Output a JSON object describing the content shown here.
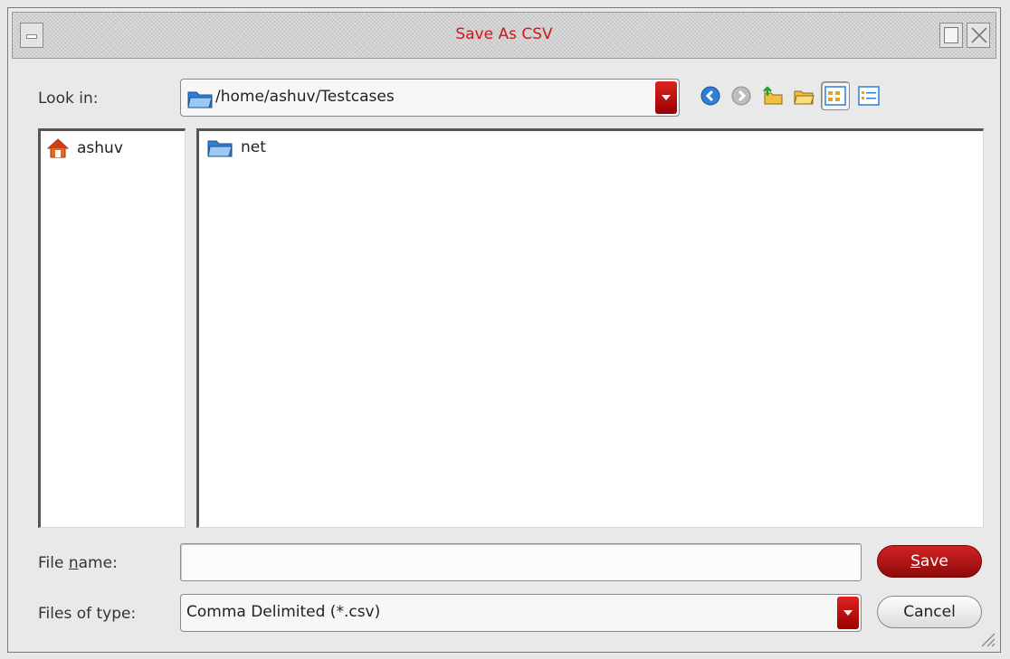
{
  "window": {
    "title": "Save As CSV"
  },
  "look_in": {
    "label": "Look in:",
    "path": "/home/ashuv/Testcases"
  },
  "toolbar": {
    "icons": [
      "back-icon",
      "forward-icon",
      "up-folder-icon",
      "new-folder-icon",
      "list-view-icon",
      "detail-view-icon"
    ],
    "active_view": "list-view"
  },
  "sidebar": {
    "items": [
      {
        "label": "ashuv",
        "icon": "home-icon"
      }
    ]
  },
  "files": {
    "items": [
      {
        "name": "net",
        "icon": "folder-icon"
      }
    ]
  },
  "file_name": {
    "label_prefix": "File ",
    "label_mnemonic": "n",
    "label_suffix": "ame:",
    "value": ""
  },
  "file_type": {
    "label": "Files of type:",
    "selected": "Comma Delimited (*.csv)"
  },
  "buttons": {
    "save_mnemonic": "S",
    "save_rest": "ave",
    "cancel": "Cancel"
  },
  "colors": {
    "accent": "#c81818",
    "title_text": "#cc1818",
    "folder_blue": "#2f7fd6"
  }
}
